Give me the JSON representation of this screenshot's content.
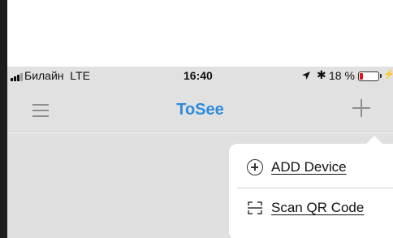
{
  "status_bar": {
    "carrier": "Билайн",
    "network": "LTE",
    "time": "16:40",
    "battery_percent": "18 %",
    "battery_level": 0.18,
    "icons": [
      "signal-bars-icon",
      "location-arrow-icon",
      "bluetooth-icon",
      "battery-icon",
      "charging-icon"
    ]
  },
  "nav_bar": {
    "title": "ToSee",
    "title_color": "#2e8bdd",
    "left_icon": "hamburger-menu-icon",
    "right_icon": "plus-icon"
  },
  "dropdown_menu": {
    "items": [
      {
        "label": "ADD Device",
        "icon": "plus-circle-icon"
      },
      {
        "label": "Scan QR Code",
        "icon": "scan-qr-icon"
      }
    ]
  }
}
